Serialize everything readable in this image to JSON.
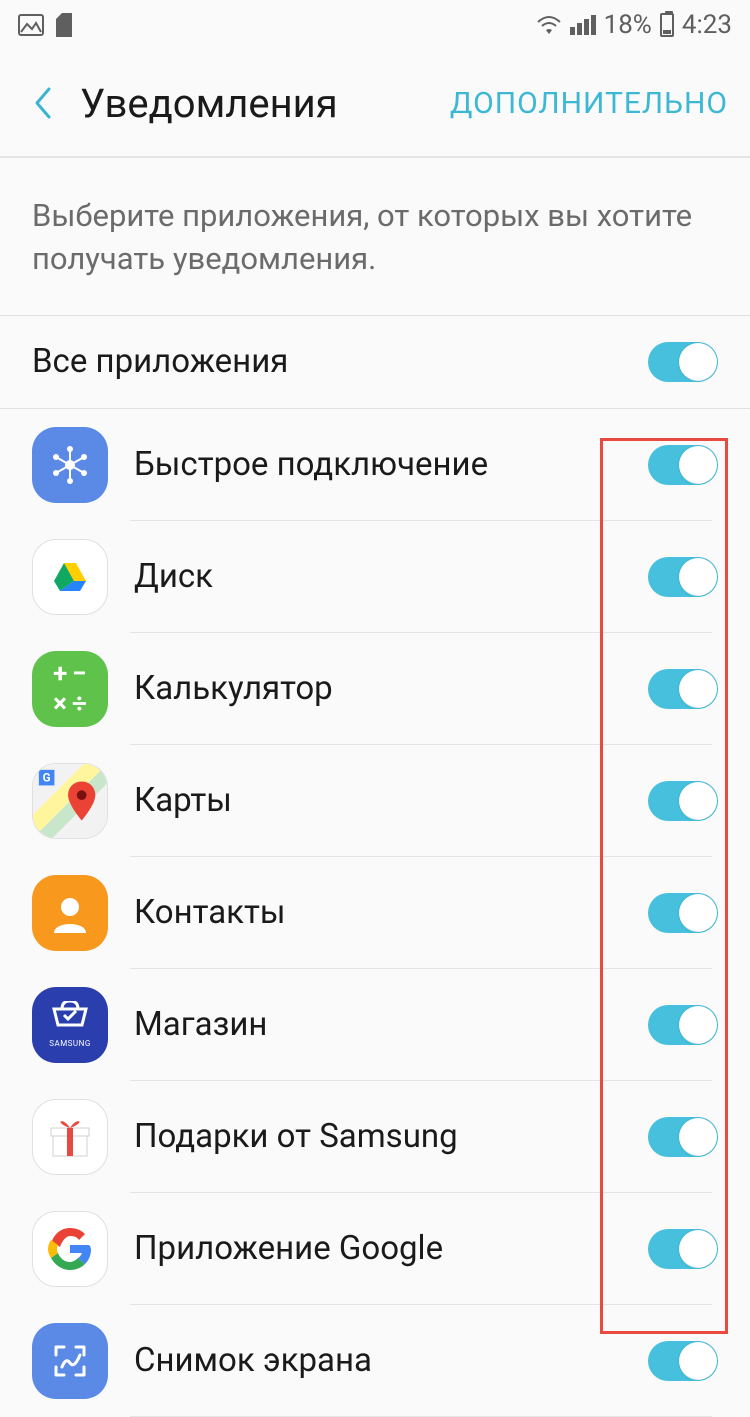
{
  "status": {
    "battery_pct": "18%",
    "time": "4:23"
  },
  "header": {
    "title": "Уведомления",
    "action": "ДОПОЛНИТЕЛЬНО"
  },
  "description": "Выберите приложения, от которых вы хотите получать уведомления.",
  "all_apps": {
    "label": "Все приложения",
    "enabled": true
  },
  "apps": [
    {
      "name": "Быстрое подключение",
      "icon": "quick-connect-icon",
      "enabled": true
    },
    {
      "name": "Диск",
      "icon": "drive-icon",
      "enabled": true
    },
    {
      "name": "Калькулятор",
      "icon": "calculator-icon",
      "enabled": true
    },
    {
      "name": "Карты",
      "icon": "maps-icon",
      "enabled": true
    },
    {
      "name": "Контакты",
      "icon": "contacts-icon",
      "enabled": true
    },
    {
      "name": "Магазин",
      "icon": "store-icon",
      "enabled": true
    },
    {
      "name": "Подарки от Samsung",
      "icon": "gifts-icon",
      "enabled": true
    },
    {
      "name": "Приложение Google",
      "icon": "google-icon",
      "enabled": true
    },
    {
      "name": "Снимок экрана",
      "icon": "screenshot-icon",
      "enabled": true
    }
  ],
  "store_sublabel": "SAMSUNG"
}
